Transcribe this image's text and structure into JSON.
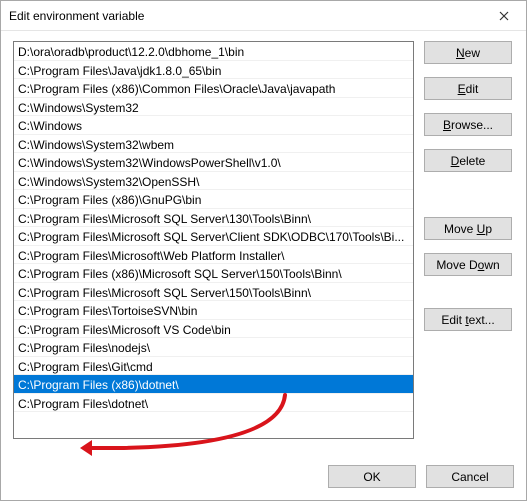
{
  "window": {
    "title": "Edit environment variable"
  },
  "paths": [
    "D:\\ora\\oradb\\product\\12.2.0\\dbhome_1\\bin",
    "C:\\Program Files\\Java\\jdk1.8.0_65\\bin",
    "C:\\Program Files (x86)\\Common Files\\Oracle\\Java\\javapath",
    "C:\\Windows\\System32",
    "C:\\Windows",
    "C:\\Windows\\System32\\wbem",
    "C:\\Windows\\System32\\WindowsPowerShell\\v1.0\\",
    "C:\\Windows\\System32\\OpenSSH\\",
    "C:\\Program Files (x86)\\GnuPG\\bin",
    "C:\\Program Files\\Microsoft SQL Server\\130\\Tools\\Binn\\",
    "C:\\Program Files\\Microsoft SQL Server\\Client SDK\\ODBC\\170\\Tools\\Bi...",
    "C:\\Program Files\\Microsoft\\Web Platform Installer\\",
    "C:\\Program Files (x86)\\Microsoft SQL Server\\150\\Tools\\Binn\\",
    "C:\\Program Files\\Microsoft SQL Server\\150\\Tools\\Binn\\",
    "C:\\Program Files\\TortoiseSVN\\bin",
    "C:\\Program Files\\Microsoft VS Code\\bin",
    "C:\\Program Files\\nodejs\\",
    "C:\\Program Files\\Git\\cmd",
    "C:\\Program Files (x86)\\dotnet\\",
    "C:\\Program Files\\dotnet\\"
  ],
  "selected_index": 18,
  "buttons": {
    "new": {
      "pre": "",
      "u": "N",
      "post": "ew"
    },
    "edit": {
      "pre": "",
      "u": "E",
      "post": "dit"
    },
    "browse": {
      "pre": "",
      "u": "B",
      "post": "rowse..."
    },
    "delete": {
      "pre": "",
      "u": "D",
      "post": "elete"
    },
    "moveup": {
      "pre": "Move ",
      "u": "U",
      "post": "p"
    },
    "movedown": {
      "pre": "Move D",
      "u": "o",
      "post": "wn"
    },
    "edittext": {
      "pre": "Edit ",
      "u": "t",
      "post": "ext..."
    },
    "ok": "OK",
    "cancel": "Cancel"
  },
  "annotation": {
    "color": "#d9141b"
  }
}
